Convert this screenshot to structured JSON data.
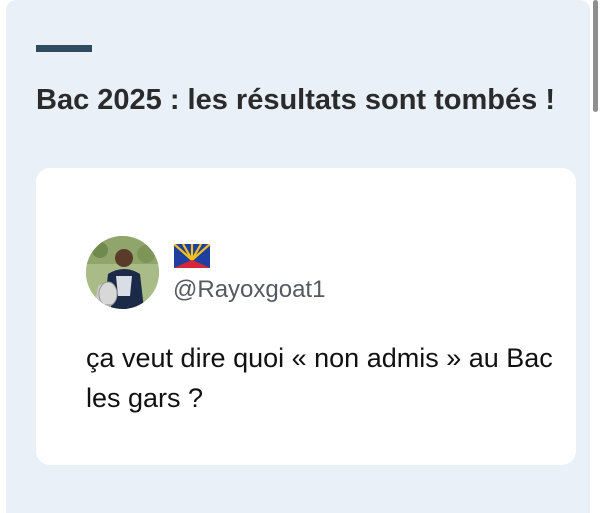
{
  "article": {
    "title": "Bac 2025 : les résultats sont tombés !"
  },
  "tweet": {
    "handle": "@Rayoxgoat1",
    "text": "ça veut dire quoi « non admis » au Bac les gars ?",
    "avatar_icon": "profile-photo-player-with-trophy",
    "flag_icon": "reunion-island-flag"
  },
  "colors": {
    "panel_bg": "#e9f0f8",
    "accent": "#2f4b5f",
    "headline": "#2b2b2b",
    "card_bg": "#ffffff"
  }
}
